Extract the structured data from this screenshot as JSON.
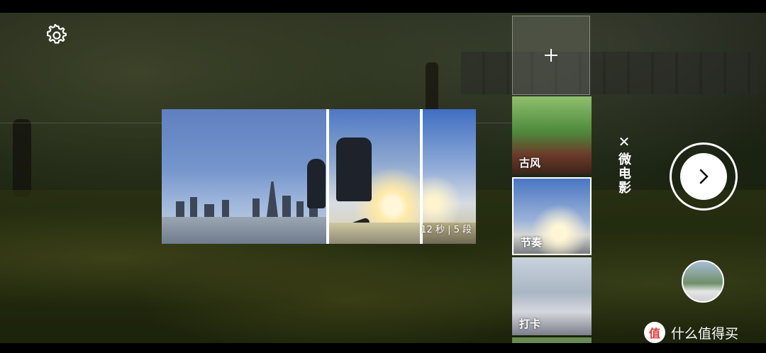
{
  "preview": {
    "info": "12 秒 | 5 段"
  },
  "templates": [
    {
      "label": "古风"
    },
    {
      "label": "节奏",
      "selected": true
    },
    {
      "label": "打卡"
    }
  ],
  "mode": {
    "label": "微电影"
  },
  "controls": {
    "close_symbol": "✕"
  },
  "watermark": {
    "badge": "值",
    "text": "什么值得买"
  },
  "colors": {
    "accent": "#ffffff",
    "watermark_badge": "#e53935"
  }
}
